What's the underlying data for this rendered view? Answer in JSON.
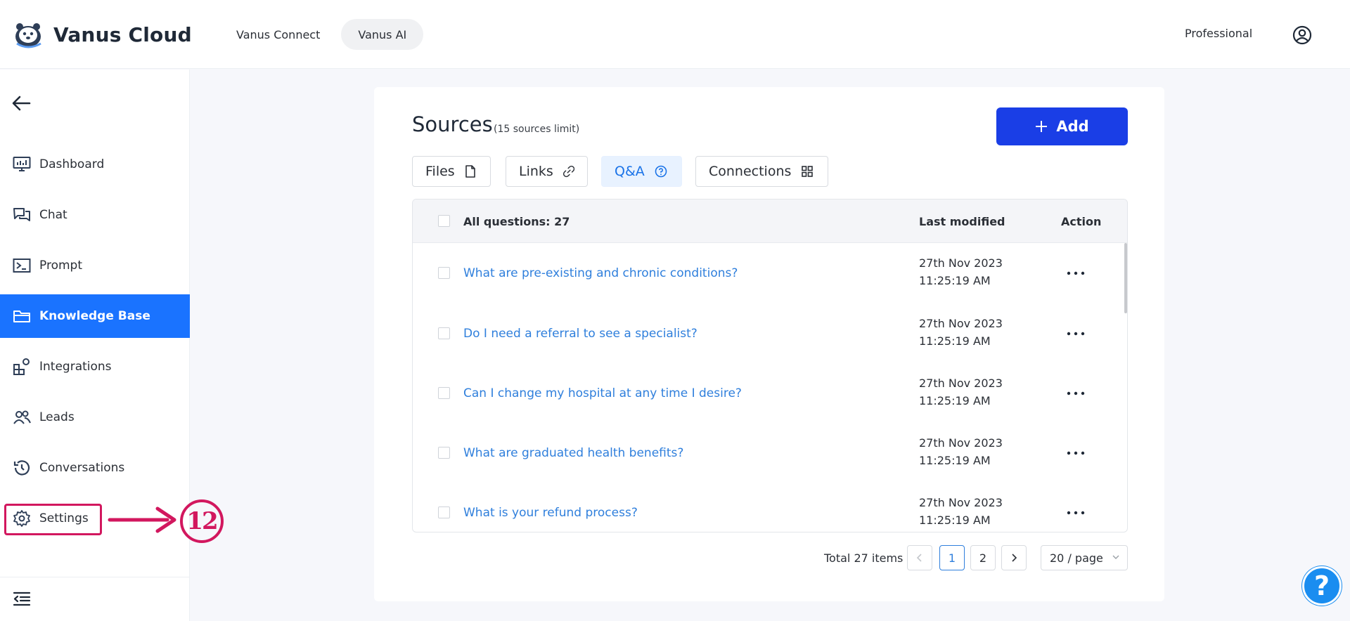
{
  "app": {
    "title": "Vanus Cloud",
    "logo_icon": "otter-logo-icon"
  },
  "topnav": {
    "items": [
      {
        "label": "Vanus Connect",
        "active": false
      },
      {
        "label": "Vanus AI",
        "active": true
      }
    ],
    "plan": "Professional",
    "user_icon": "user-circle-icon"
  },
  "sidebar": {
    "back_icon": "arrow-left-icon",
    "items": [
      {
        "label": "Dashboard",
        "icon": "monitor-chart-icon",
        "active": false
      },
      {
        "label": "Chat",
        "icon": "chat-bubbles-icon",
        "active": false
      },
      {
        "label": "Prompt",
        "icon": "terminal-icon",
        "active": false
      },
      {
        "label": "Knowledge Base",
        "icon": "folder-icon",
        "active": true
      },
      {
        "label": "Integrations",
        "icon": "blocks-icon",
        "active": false
      },
      {
        "label": "Leads",
        "icon": "users-icon",
        "active": false
      },
      {
        "label": "Conversations",
        "icon": "history-icon",
        "active": false
      },
      {
        "label": "Settings",
        "icon": "gear-icon",
        "active": false
      }
    ],
    "collapse_icon": "collapse-menu-icon"
  },
  "annotation": {
    "step_number": "12",
    "color": "#d2175e"
  },
  "sources": {
    "title": "Sources",
    "limit": "(15 sources limit)",
    "add_label": "Add",
    "tabs": [
      {
        "label": "Files",
        "icon": "file-icon",
        "active": false
      },
      {
        "label": "Links",
        "icon": "link-icon",
        "active": false
      },
      {
        "label": "Q&A",
        "icon": "question-circle-icon",
        "active": true
      },
      {
        "label": "Connections",
        "icon": "grid-icon",
        "active": false
      }
    ]
  },
  "table": {
    "header_all": "All questions: 27",
    "header_modified": "Last modified",
    "header_action": "Action",
    "rows": [
      {
        "question": "What are pre-existing and chronic conditions?",
        "date": "27th Nov 2023",
        "time": "11:25:19 AM"
      },
      {
        "question": "Do I need a referral to see a specialist?",
        "date": "27th Nov 2023",
        "time": "11:25:19 AM"
      },
      {
        "question": "Can I change my hospital at any time I desire?",
        "date": "27th Nov 2023",
        "time": "11:25:19 AM"
      },
      {
        "question": "What are graduated health benefits?",
        "date": "27th Nov 2023",
        "time": "11:25:19 AM"
      },
      {
        "question": "What is your refund process?",
        "date": "27th Nov 2023",
        "time": "11:25:19 AM"
      }
    ]
  },
  "pagination": {
    "total": "Total 27 items",
    "pages": [
      "1",
      "2"
    ],
    "current": "1",
    "page_size": "20 / page"
  },
  "help": {
    "label": "?"
  },
  "colors": {
    "accent": "#1a73ff",
    "add_button": "#1a3ee6",
    "link": "#2f7fdc"
  }
}
